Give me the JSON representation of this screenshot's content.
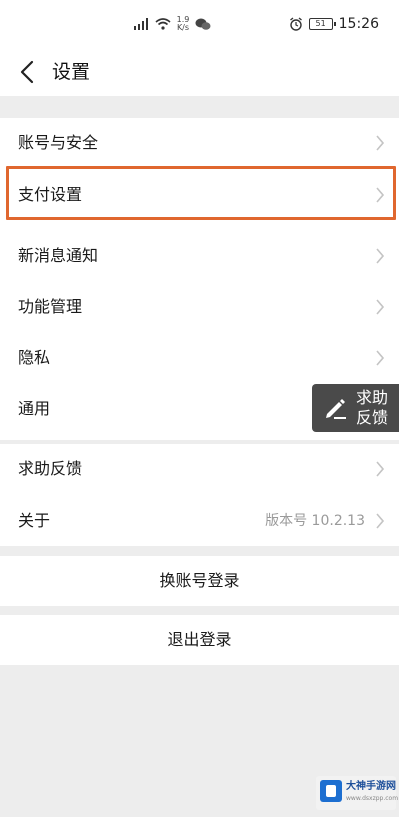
{
  "status_bar": {
    "net_speed_value": "1.9",
    "net_speed_unit": "K/s",
    "battery_level": "51",
    "time": "15:26"
  },
  "nav": {
    "title": "设置"
  },
  "settings": {
    "items": [
      {
        "label": "账号与安全"
      },
      {
        "label": "支付设置"
      },
      {
        "label": "新消息通知"
      },
      {
        "label": "功能管理"
      },
      {
        "label": "隐私"
      },
      {
        "label": "通用"
      },
      {
        "label": "求助反馈"
      },
      {
        "label": "关于",
        "value": "版本号 10.2.13"
      }
    ],
    "switch_account": "换账号登录",
    "logout": "退出登录"
  },
  "help_float": {
    "line1": "求助",
    "line2": "反馈"
  },
  "watermark": {
    "name": "大神手游网",
    "site": "www.dsxzpp.com"
  },
  "colors": {
    "highlight": "#e0672f",
    "background": "#ededed"
  }
}
